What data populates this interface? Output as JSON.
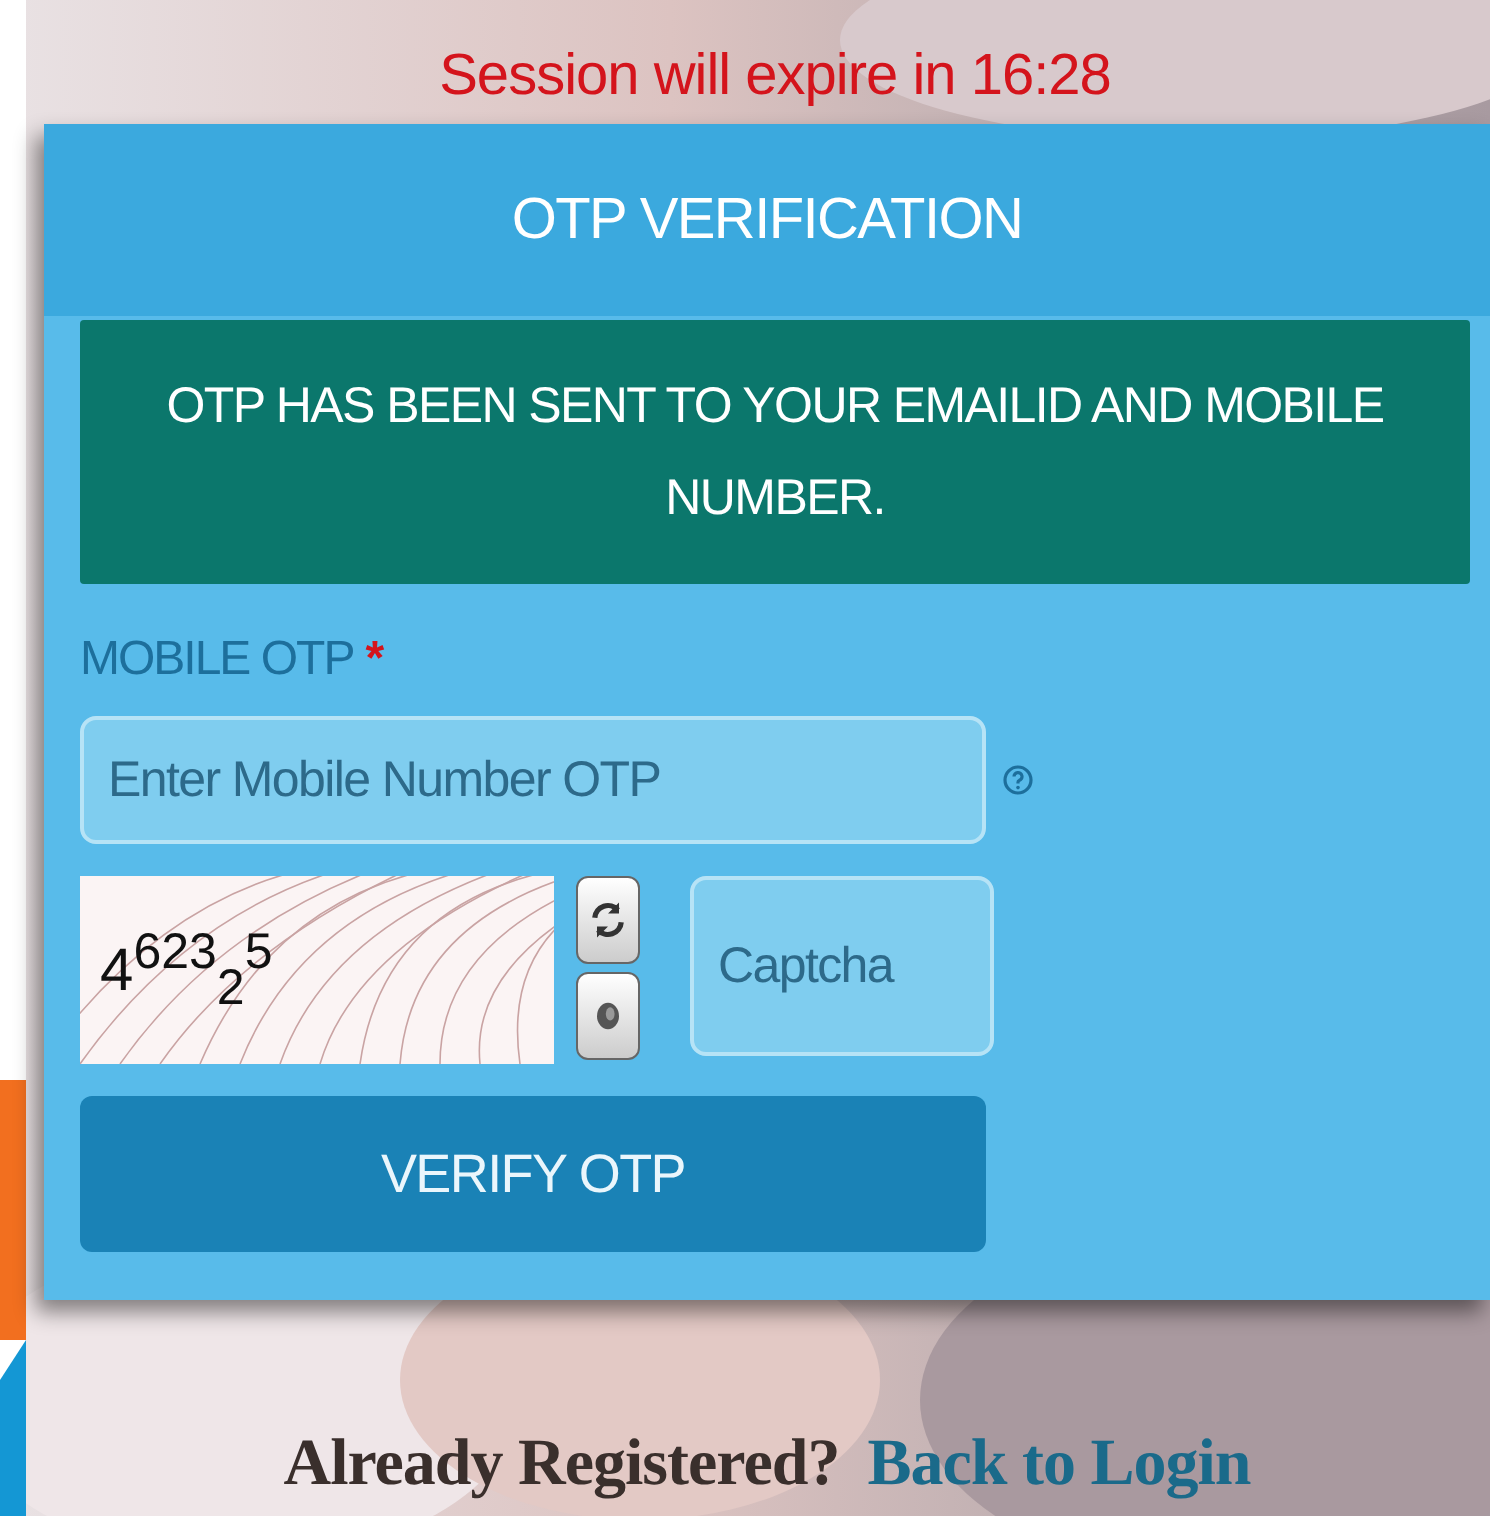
{
  "session_notice": "Session will expire in 16:28",
  "card": {
    "title": "OTP VERIFICATION",
    "alert": "OTP HAS BEEN SENT TO YOUR EMAILID AND MOBILE NUMBER.",
    "mobile_otp": {
      "label": "MOBILE OTP",
      "required_mark": "*",
      "placeholder": "Enter Mobile Number OTP"
    },
    "captcha": {
      "text": "4$^{623}$$_{2}$$^{5}$",
      "placeholder": "Captcha"
    },
    "verify_button": "VERIFY OTP"
  },
  "footer": {
    "text": "Already Registered?",
    "link": "Back to Login"
  }
}
